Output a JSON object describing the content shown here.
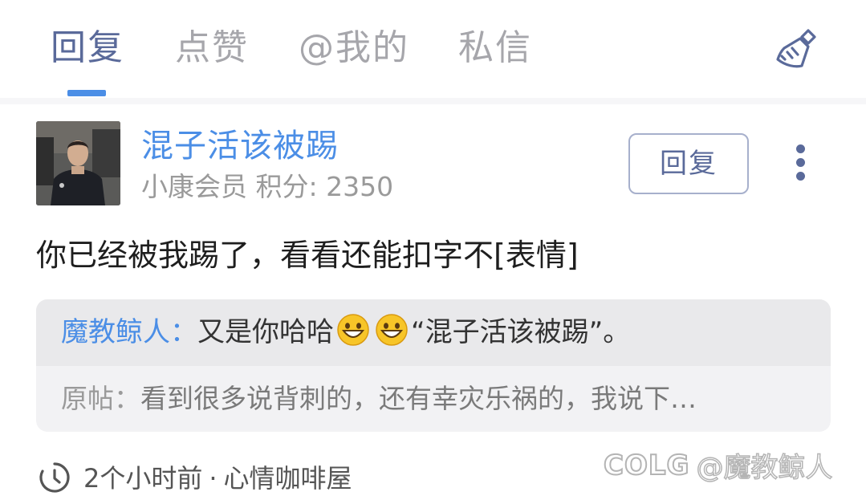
{
  "tabs": [
    {
      "label": "回复",
      "active": true
    },
    {
      "label": "点赞",
      "active": false
    },
    {
      "label": "@我的",
      "active": false
    },
    {
      "label": "私信",
      "active": false
    }
  ],
  "header": {
    "clear_icon": "broom-icon"
  },
  "post": {
    "username": "混子活该被踢",
    "user_level": "小康会员 积分: 2350",
    "reply_button": "回复",
    "content": "你已经被我踢了，看看还能扣字不[表情]",
    "quote": {
      "author": "魔教鲸人",
      "separator": "：",
      "text_before_emoji": "又是你哈哈",
      "emoji": "grinning-face",
      "text_after_emoji": "“混子活该被踢”。"
    },
    "original": {
      "label": "原帖：",
      "text": "看到很多说背刺的，还有幸灾乐祸的，我说下…"
    },
    "time": "2个小时前",
    "separator_dot": "·",
    "forum": "心情咖啡屋"
  },
  "watermark": {
    "logo": "COLG",
    "handle": "@魔教鲸人"
  },
  "colors": {
    "accent": "#4b8ee6",
    "tab_active": "#5a6a9a",
    "tab_inactive": "#a6a6ab",
    "quote_bg": "#e9e9eb"
  }
}
